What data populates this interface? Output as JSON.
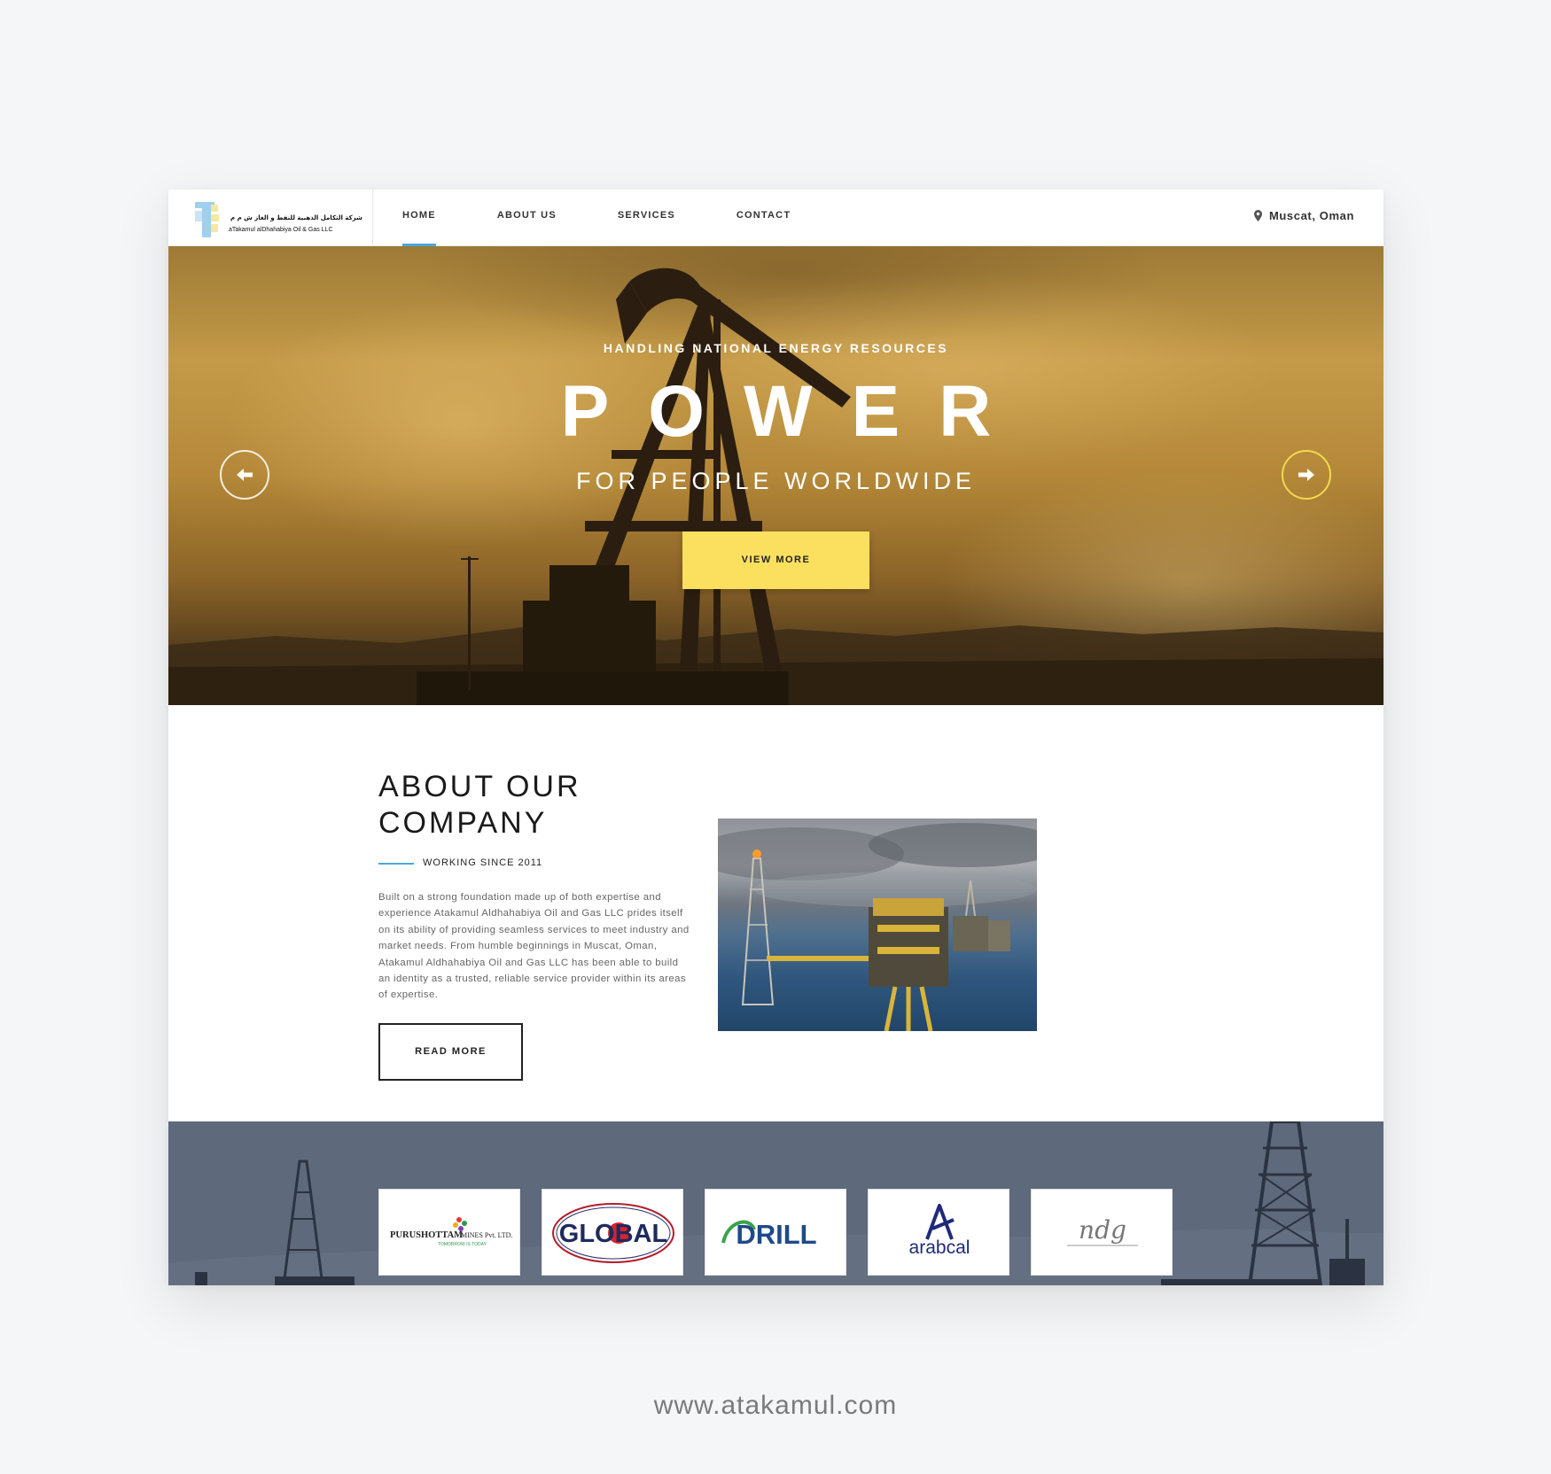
{
  "header": {
    "logo_arabic": "شركة التكامل الذهبية للنفط و الغاز ش م م",
    "logo_english": "aTakamul alDhahabiya Oil & Gas LLC",
    "nav": [
      {
        "label": "HOME",
        "active": true
      },
      {
        "label": "ABOUT US",
        "active": false
      },
      {
        "label": "SERVICES",
        "active": false
      },
      {
        "label": "CONTACT",
        "active": false
      }
    ],
    "location": "Muscat, Oman"
  },
  "hero": {
    "eyebrow": "HANDLING NATIONAL ENERGY RESOURCES",
    "headline": "POWER",
    "subheadline": "FOR PEOPLE WORLDWIDE",
    "cta_label": "VIEW MORE"
  },
  "about": {
    "title_line1": "ABOUT OUR",
    "title_line2": "COMPANY",
    "since": "WORKING SINCE 2011",
    "body": "Built on a strong foundation made up of both expertise and experience Atakamul Aldhahabiya Oil and Gas LLC prides itself on its ability of providing seamless services to meet industry and market needs. From humble beginnings in Muscat, Oman, Atakamul Aldhahabiya Oil and Gas LLC has been able to build an identity as a trusted, reliable service provider within its areas of expertise.",
    "read_more_label": "READ MORE"
  },
  "clients": [
    {
      "name": "PURUSHOTTAM",
      "extra": "MINES Pvt. LTD.",
      "tagline": "TOMORROW IS TODAY"
    },
    {
      "name": "GLOBAL"
    },
    {
      "name": "DRILL"
    },
    {
      "name": "arabcal"
    },
    {
      "name": "ndg"
    }
  ],
  "footer_url": "www.atakamul.com",
  "colors": {
    "accent_blue": "#4aa8d8",
    "cta_yellow": "#fbe060",
    "clients_band": "#5e697b"
  }
}
